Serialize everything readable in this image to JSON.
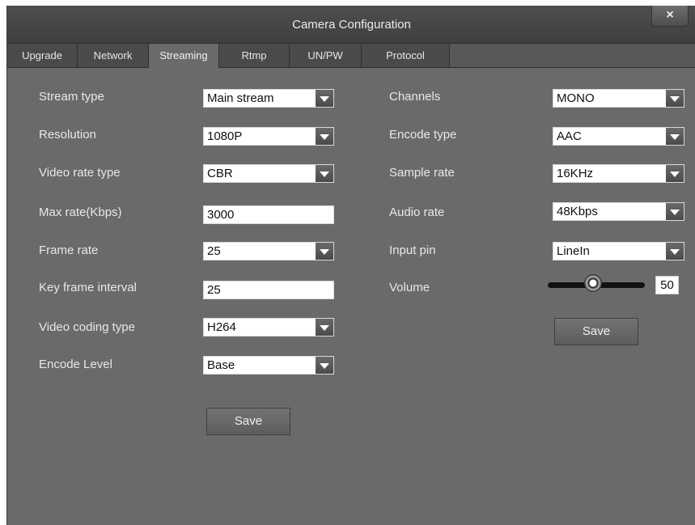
{
  "window": {
    "title": "Camera Configuration",
    "close_label": "×"
  },
  "tabs": [
    "Upgrade",
    "Network",
    "Streaming",
    "Rtmp",
    "UN/PW",
    "Protocol"
  ],
  "active_tab": "Streaming",
  "video": {
    "stream_type": {
      "label": "Stream type",
      "value": "Main stream"
    },
    "resolution": {
      "label": "Resolution",
      "value": "1080P"
    },
    "video_rate_type": {
      "label": "Video rate type",
      "value": "CBR"
    },
    "max_rate": {
      "label": "Max rate(Kbps)",
      "value": "3000"
    },
    "frame_rate": {
      "label": "Frame rate",
      "value": "25"
    },
    "key_frame_interval": {
      "label": "Key frame interval",
      "value": "25"
    },
    "video_coding_type": {
      "label": "Video coding type",
      "value": "H264"
    },
    "encode_level": {
      "label": "Encode Level",
      "value": "Base"
    },
    "save_label": "Save"
  },
  "audio": {
    "channels": {
      "label": "Channels",
      "value": "MONO"
    },
    "encode_type": {
      "label": "Encode type",
      "value": "AAC"
    },
    "sample_rate": {
      "label": "Sample rate",
      "value": "16KHz"
    },
    "audio_rate": {
      "label": "Audio rate",
      "value": "48Kbps"
    },
    "input_pin": {
      "label": "Input pin",
      "value": "LineIn"
    },
    "volume": {
      "label": "Volume",
      "value": "50"
    },
    "save_label": "Save"
  },
  "colors": {
    "panel": "#6a6a6a",
    "titlebar": "#454545",
    "tab_inactive": "#4a4a4a"
  }
}
